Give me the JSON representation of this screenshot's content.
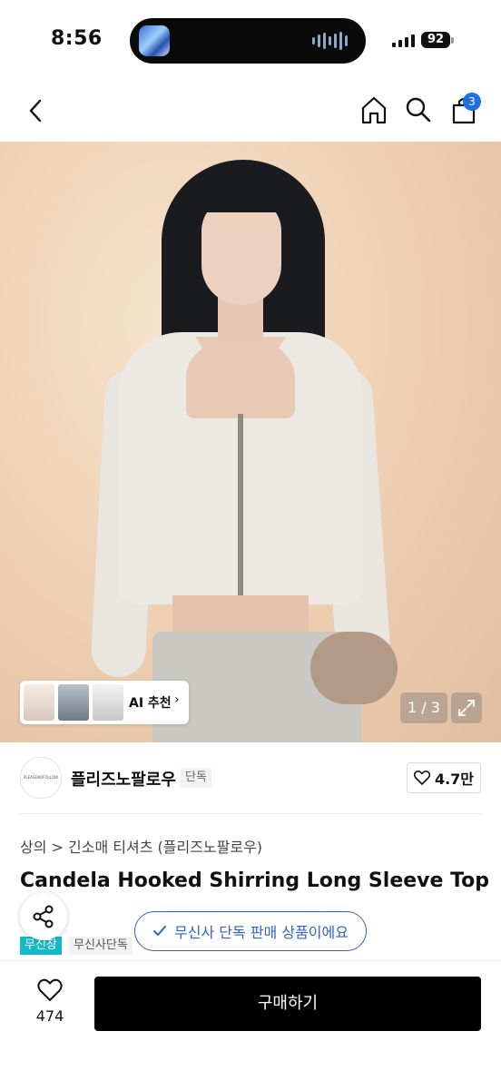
{
  "status_bar": {
    "time": "8:56",
    "battery": "92"
  },
  "header": {
    "back_icon": "chevron-left-icon",
    "home_icon": "home-icon",
    "search_icon": "search-icon",
    "cart_icon": "cart-icon",
    "cart_count": "3"
  },
  "gallery": {
    "ai_label": "AI 추천",
    "counter": "1 / 3",
    "thumbnails": 3
  },
  "brand": {
    "name": "플리즈노팔로우",
    "badge": "단독",
    "logo_text": "PLEASENOFOLLOW",
    "likes": "4.7만"
  },
  "product": {
    "breadcrumb": "상의 > 긴소매 티셔츠 (플리즈노팔로우)",
    "title": "Candela Hooked Shirring Long Sleeve Top (Iv",
    "tags": [
      "무신장",
      "무신사단독"
    ],
    "exclusive_notice": "무신사 단독 판매 상품이에요"
  },
  "bottom": {
    "wish_count": "474",
    "buy_label": "구매하기"
  },
  "colors": {
    "accent_blue": "#2f63c8",
    "badge_blue": "#1f6fe0",
    "tag_teal": "#15b9c8"
  }
}
